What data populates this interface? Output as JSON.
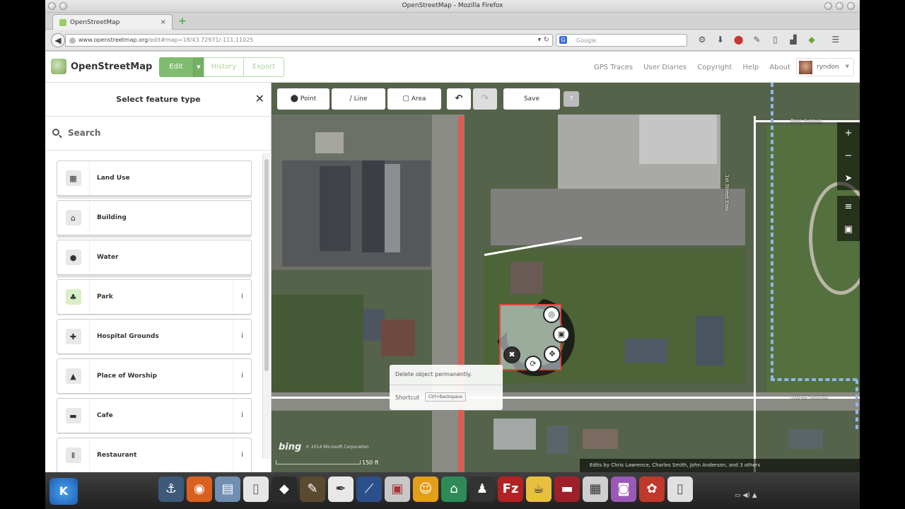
{
  "browser": {
    "window_title": "OpenStreetMap - Mozilla Firefox",
    "tab_label": "OpenStreetMap",
    "url_host": "www.openstreetmap.org",
    "url_path": "/edit#map=18/43.72971/-111.11025",
    "search_engine_placeholder": "Google"
  },
  "osm": {
    "brand": "OpenStreetMap",
    "edit_label": "Edit",
    "history_label": "History",
    "export_label": "Export",
    "links": [
      "GPS Traces",
      "User Diaries",
      "Copyright",
      "Help",
      "About"
    ],
    "username": "ryndon"
  },
  "sidebar": {
    "title": "Select feature type",
    "search_placeholder": "Search",
    "presets": [
      {
        "label": "Land Use",
        "icon": "land-use-icon",
        "glyph": "▦",
        "group": true,
        "info": false
      },
      {
        "label": "Building",
        "icon": "building-icon",
        "glyph": "⌂",
        "group": true,
        "info": false
      },
      {
        "label": "Water",
        "icon": "water-icon",
        "glyph": "●",
        "group": true,
        "info": false
      },
      {
        "label": "Park",
        "icon": "park-icon",
        "glyph": "♣",
        "group": false,
        "info": true
      },
      {
        "label": "Hospital Grounds",
        "icon": "hospital-icon",
        "glyph": "✚",
        "group": false,
        "info": true
      },
      {
        "label": "Place of Worship",
        "icon": "worship-icon",
        "glyph": "▲",
        "group": false,
        "info": true
      },
      {
        "label": "Cafe",
        "icon": "cafe-icon",
        "glyph": "▬",
        "group": false,
        "info": true
      },
      {
        "label": "Restaurant",
        "icon": "restaurant-icon",
        "glyph": "Ⅱ",
        "group": false,
        "info": true
      }
    ]
  },
  "map_toolbar": {
    "point_label": "Point",
    "line_label": "Line",
    "area_label": "Area",
    "save_label": "Save",
    "save_count": "7"
  },
  "map": {
    "street_labels": [
      "Ross Avenue",
      "1st Street East",
      "Harper Avenue"
    ],
    "tooltip_title": "Delete object permanently.",
    "tooltip_shortcut_label": "Shortcut",
    "tooltip_shortcut_key": "Ctrl+Backspace",
    "imagery_brand": "bing",
    "imagery_copyright": "© 2014 Microsoft Corporation",
    "scale": "150 ft",
    "attribution": "Edits by Chris Lawrence, Charles Smith, John Anderson, and 3 others"
  },
  "colors": {
    "osm_green": "#7ebc6f",
    "selection_red": "#e3463c",
    "sidewalk_blue": "#8fb6e8"
  }
}
